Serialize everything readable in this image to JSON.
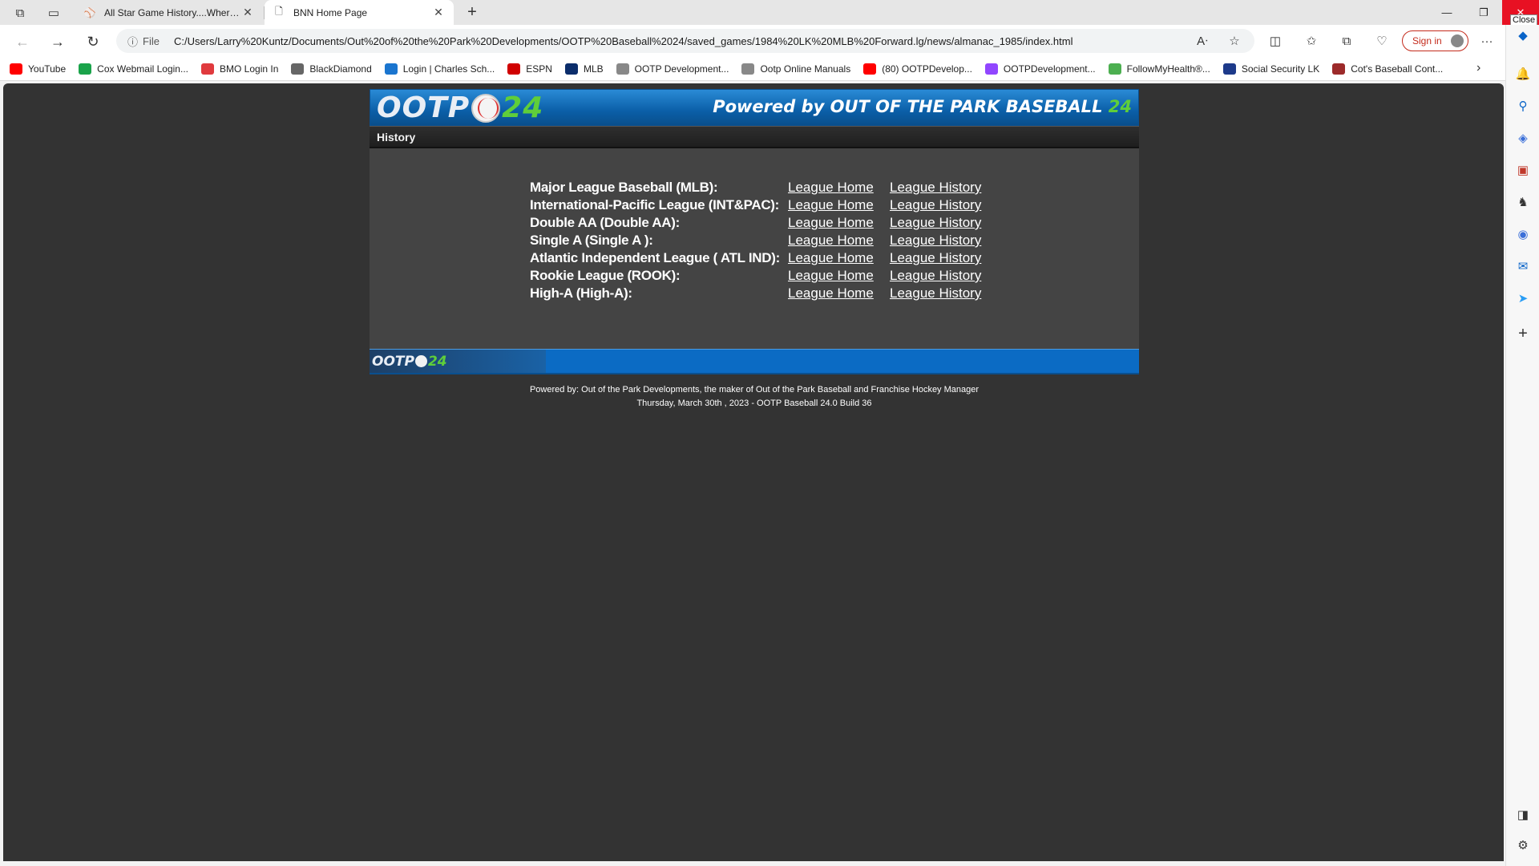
{
  "browser": {
    "tabs": [
      {
        "title": "All Star Game History....Where? -"
      },
      {
        "title": "BNN Home Page"
      }
    ],
    "close_tooltip": "Close",
    "address": {
      "file_label": "File",
      "url": "C:/Users/Larry%20Kuntz/Documents/Out%20of%20the%20Park%20Developments/OOTP%20Baseball%2024/saved_games/1984%20LK%20MLB%20Forward.lg/news/almanac_1985/index.html"
    },
    "signin_label": "Sign in",
    "favorites": [
      {
        "label": "YouTube",
        "color": "#ff0000"
      },
      {
        "label": "Cox Webmail Login...",
        "color": "#1aa34a"
      },
      {
        "label": "BMO Login In",
        "color": "#e03a3e"
      },
      {
        "label": "BlackDiamond",
        "color": "#666666"
      },
      {
        "label": "Login | Charles Sch...",
        "color": "#1a75cf"
      },
      {
        "label": "ESPN",
        "color": "#d00000"
      },
      {
        "label": "MLB",
        "color": "#0b2d6b"
      },
      {
        "label": "OOTP Development...",
        "color": "#888888"
      },
      {
        "label": "Ootp Online Manuals",
        "color": "#888888"
      },
      {
        "label": "(80) OOTPDevelop...",
        "color": "#ff0000"
      },
      {
        "label": "OOTPDevelopment...",
        "color": "#9146ff"
      },
      {
        "label": "FollowMyHealth®...",
        "color": "#4caf50"
      },
      {
        "label": "Social Security LK",
        "color": "#1d3a8a"
      },
      {
        "label": "Cot's Baseball Cont...",
        "color": "#9c2a2a"
      }
    ]
  },
  "page": {
    "logo_text": "OOTP",
    "logo_num": "24",
    "powered_text": "Powered by OUT OF THE PARK BASEBALL",
    "powered_num": "24",
    "subnav_history": "History",
    "leagues": [
      {
        "name": "Major League Baseball (MLB):",
        "home": "League Home",
        "history": "League History"
      },
      {
        "name": "International-Pacific League (INT&PAC):",
        "home": "League Home",
        "history": "League History"
      },
      {
        "name": "Double AA (Double AA):",
        "home": "League Home",
        "history": "League History"
      },
      {
        "name": "Single A (Single A ):",
        "home": "League Home",
        "history": "League History"
      },
      {
        "name": "Atlantic Independent League ( ATL IND):",
        "home": "League Home",
        "history": "League History"
      },
      {
        "name": "Rookie League (ROOK):",
        "home": "League Home",
        "history": "League History"
      },
      {
        "name": "High-A (High-A):",
        "home": "League Home",
        "history": "League History"
      }
    ],
    "footer_logo_text": "OOTP",
    "footer_logo_num": "24",
    "credits_line1": "Powered by: Out of the Park Developments, the maker of Out of the Park Baseball and Franchise Hockey Manager",
    "credits_line2": "Thursday, March 30th , 2023 - OOTP Baseball 24.0 Build 36"
  }
}
